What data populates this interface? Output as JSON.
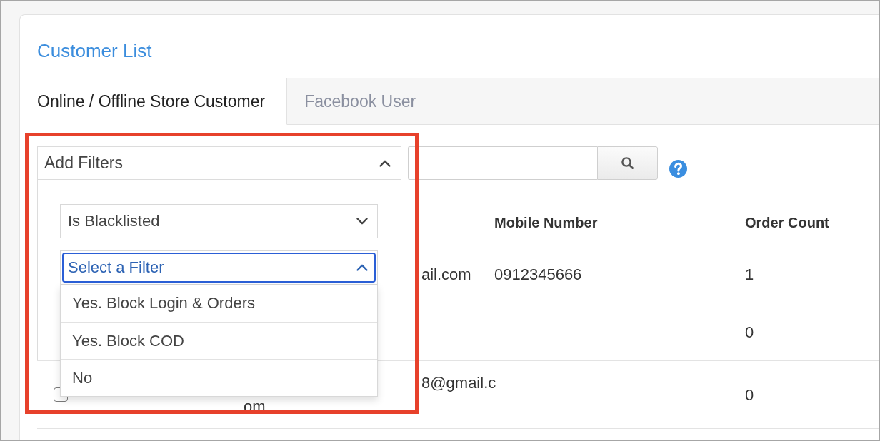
{
  "header": {
    "title": "Customer List"
  },
  "tabs": [
    {
      "label": "Online / Offline Store Customer",
      "selected": true
    },
    {
      "label": "Facebook User",
      "selected": false
    }
  ],
  "filters": {
    "label": "Add Filters",
    "expanded": true,
    "field_select": {
      "value": "Is Blacklisted",
      "expanded": false
    },
    "value_select": {
      "value": "Select a Filter",
      "expanded": true,
      "focused": true,
      "options": [
        {
          "label": "Yes. Block Login & Orders",
          "selected": false
        },
        {
          "label": "Yes. Block COD",
          "selected": false
        },
        {
          "label": "No",
          "selected": false
        }
      ]
    }
  },
  "table": {
    "columns": [
      "Mobile Number",
      "Order Count"
    ],
    "rows": [
      {
        "column_3": [
          "ail.com"
        ],
        "mobile_number": "0912345666",
        "order_count": "1"
      },
      {
        "order_count": "0"
      },
      {
        "checked": false,
        "column_3": [
          "8@gmail.c",
          "om"
        ],
        "order_count": "0"
      }
    ]
  }
}
